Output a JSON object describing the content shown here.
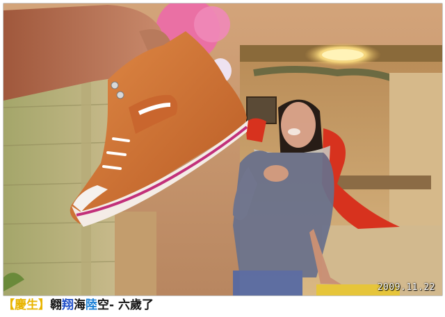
{
  "photo": {
    "date_stamp": "2009.11.22"
  },
  "caption": {
    "bracket_open": "【",
    "tag": "慶生",
    "bracket_close": "】",
    "part1": "翱",
    "part2": "翔",
    "part3": "海",
    "part4": "陸",
    "part5": "空",
    "part6": " - 六歲了"
  },
  "colors": {
    "caption_bracket": "#e8b400",
    "caption_blue": "#1f4ec8",
    "caption_black": "#111111"
  }
}
